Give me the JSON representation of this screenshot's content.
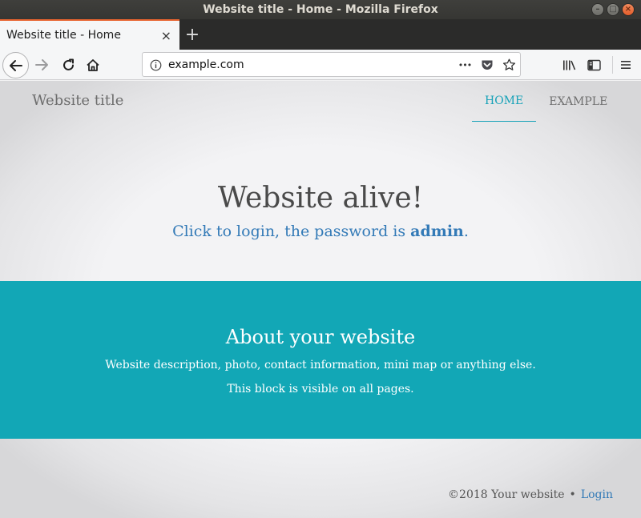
{
  "window": {
    "title": "Website title - Home - Mozilla Firefox",
    "controls": {
      "minimize": "–",
      "maximize": "□",
      "close": "×"
    }
  },
  "tabs": [
    {
      "title": "Website title - Home",
      "close": "×"
    }
  ],
  "new_tab_label": "+",
  "toolbar": {
    "url": "example.com",
    "page_actions": "•••",
    "icons": [
      "back-icon",
      "forward-icon",
      "reload-icon",
      "home-icon",
      "info-icon",
      "pocket-icon",
      "bookmark-star-icon",
      "library-icon",
      "sidebar-icon",
      "menu-icon"
    ]
  },
  "site": {
    "title": "Website title",
    "nav": [
      {
        "label": "HOME",
        "active": true
      },
      {
        "label": "EXAMPLE",
        "active": false
      }
    ],
    "hero": {
      "title": "Website alive!",
      "sub_prefix": "Click to login, the password is ",
      "sub_password": "admin",
      "sub_suffix": "."
    },
    "about": {
      "title": "About your website",
      "line1": "Website description, photo, contact information, mini map or anything else.",
      "line2": "This block is visible on all pages."
    },
    "footer": {
      "copyright": "©2018 Your website",
      "separator": "•",
      "login": "Login"
    }
  },
  "colors": {
    "accent": "#17a2b8",
    "about_bg": "#12a7b6",
    "link": "#337ab7",
    "tab_highlight": "#e8632e"
  }
}
